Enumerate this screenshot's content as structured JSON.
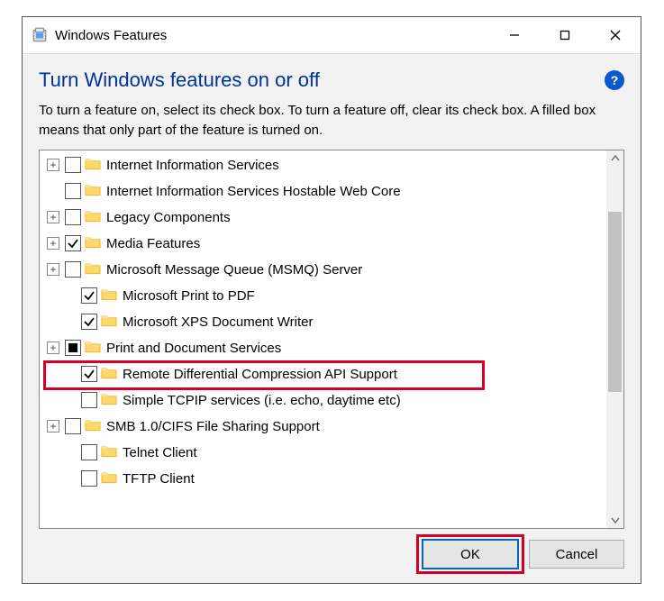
{
  "window": {
    "title": "Windows Features",
    "heading": "Turn Windows features on or off",
    "description": "To turn a feature on, select its check box. To turn a feature off, clear its check box. A filled box means that only part of the feature is turned on."
  },
  "buttons": {
    "ok": "OK",
    "cancel": "Cancel"
  },
  "items": [
    {
      "exp": "+",
      "state": "empty",
      "indent": 0,
      "label": "Internet Information Services"
    },
    {
      "exp": "",
      "state": "empty",
      "indent": 0,
      "label": "Internet Information Services Hostable Web Core"
    },
    {
      "exp": "+",
      "state": "empty",
      "indent": 0,
      "label": "Legacy Components"
    },
    {
      "exp": "+",
      "state": "checked",
      "indent": 0,
      "label": "Media Features"
    },
    {
      "exp": "+",
      "state": "empty",
      "indent": 0,
      "label": "Microsoft Message Queue (MSMQ) Server"
    },
    {
      "exp": "",
      "state": "checked",
      "indent": 1,
      "label": "Microsoft Print to PDF"
    },
    {
      "exp": "",
      "state": "checked",
      "indent": 1,
      "label": "Microsoft XPS Document Writer"
    },
    {
      "exp": "+",
      "state": "filled",
      "indent": 0,
      "label": "Print and Document Services"
    },
    {
      "exp": "",
      "state": "checked",
      "indent": 1,
      "label": "Remote Differential Compression API Support"
    },
    {
      "exp": "",
      "state": "empty",
      "indent": 1,
      "label": "Simple TCPIP services (i.e. echo, daytime etc)"
    },
    {
      "exp": "+",
      "state": "empty",
      "indent": 0,
      "label": "SMB 1.0/CIFS File Sharing Support"
    },
    {
      "exp": "",
      "state": "empty",
      "indent": 1,
      "label": "Telnet Client"
    },
    {
      "exp": "",
      "state": "empty",
      "indent": 1,
      "label": "TFTP Client"
    }
  ],
  "highlight_item_index": 8
}
